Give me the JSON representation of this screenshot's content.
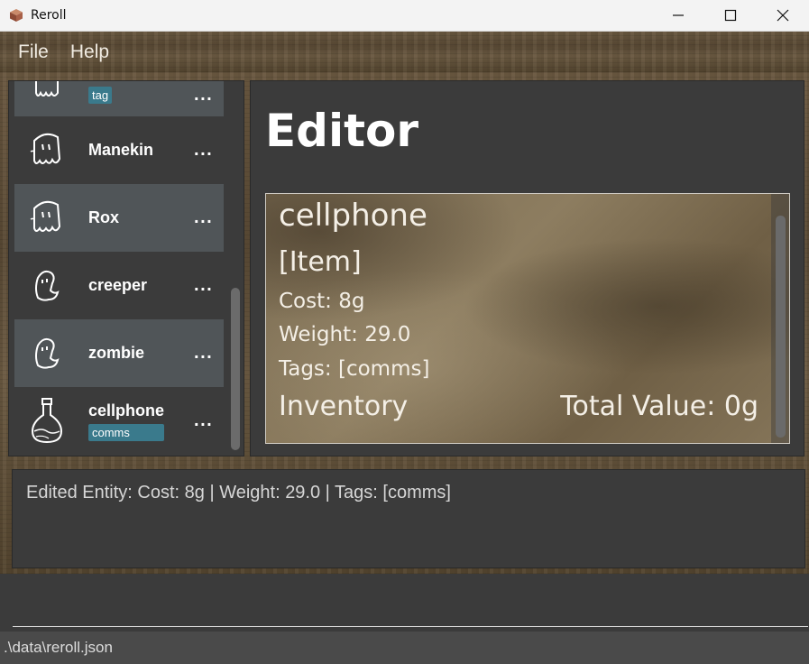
{
  "window": {
    "title": "Reroll"
  },
  "menu": {
    "items": [
      "File",
      "Help"
    ]
  },
  "list": {
    "items": [
      {
        "name": "",
        "tag": "tag",
        "icon": "ghost-icon"
      },
      {
        "name": "Manekin",
        "tag": "",
        "icon": "ghost-icon"
      },
      {
        "name": "Rox",
        "tag": "",
        "icon": "ghost-icon"
      },
      {
        "name": "creeper",
        "tag": "",
        "icon": "worm-ghost-icon"
      },
      {
        "name": "zombie",
        "tag": "",
        "icon": "worm-ghost-icon"
      },
      {
        "name": "cellphone",
        "tag": "comms",
        "icon": "potion-flask-icon"
      }
    ],
    "more_label": "..."
  },
  "editor": {
    "title": "Editor",
    "card": {
      "name": "cellphone",
      "type": "[Item]",
      "cost": "Cost: 8g",
      "weight": "Weight: 29.0",
      "tags": "Tags: [comms]",
      "inventory": "Inventory",
      "total_value": "Total Value: 0g"
    }
  },
  "result": {
    "text": "Edited Entity: Cost: 8g | Weight: 29.0 | Tags: [comms]"
  },
  "command": {
    "value": ""
  },
  "status": {
    "path": ".\\data\\reroll.json"
  },
  "colors": {
    "panel": "#3b3b3b",
    "alt_row": "#505558",
    "tag_bg": "#3a7a8c"
  }
}
